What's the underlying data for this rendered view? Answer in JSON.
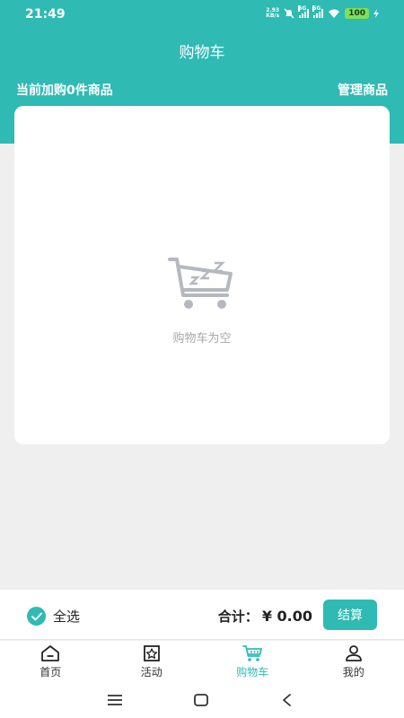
{
  "status": {
    "time": "21:49",
    "net_speed_value": "2.93",
    "net_speed_unit": "KB/s",
    "sig1": "5G",
    "sig2": "5G",
    "battery": "100"
  },
  "header": {
    "title": "购物车"
  },
  "subheader": {
    "count_text": "当前加购0件商品",
    "manage_label": "管理商品"
  },
  "empty": {
    "icon": "empty-cart-sleep-icon",
    "text": "购物车为空"
  },
  "checkout": {
    "select_all_label": "全选",
    "select_all_checked": true,
    "total_label": "合计：",
    "total_value": "¥ 0.00",
    "settle_label": "结算"
  },
  "tabbar": {
    "items": [
      {
        "label": "首页",
        "icon": "home-icon"
      },
      {
        "label": "活动",
        "icon": "activity-icon"
      },
      {
        "label": "购物车",
        "icon": "cart-icon",
        "active": true
      },
      {
        "label": "我的",
        "icon": "profile-icon"
      }
    ]
  },
  "colors": {
    "accent": "#2fbab3",
    "background": "#efefef",
    "empty_text": "#a8a8a8"
  }
}
